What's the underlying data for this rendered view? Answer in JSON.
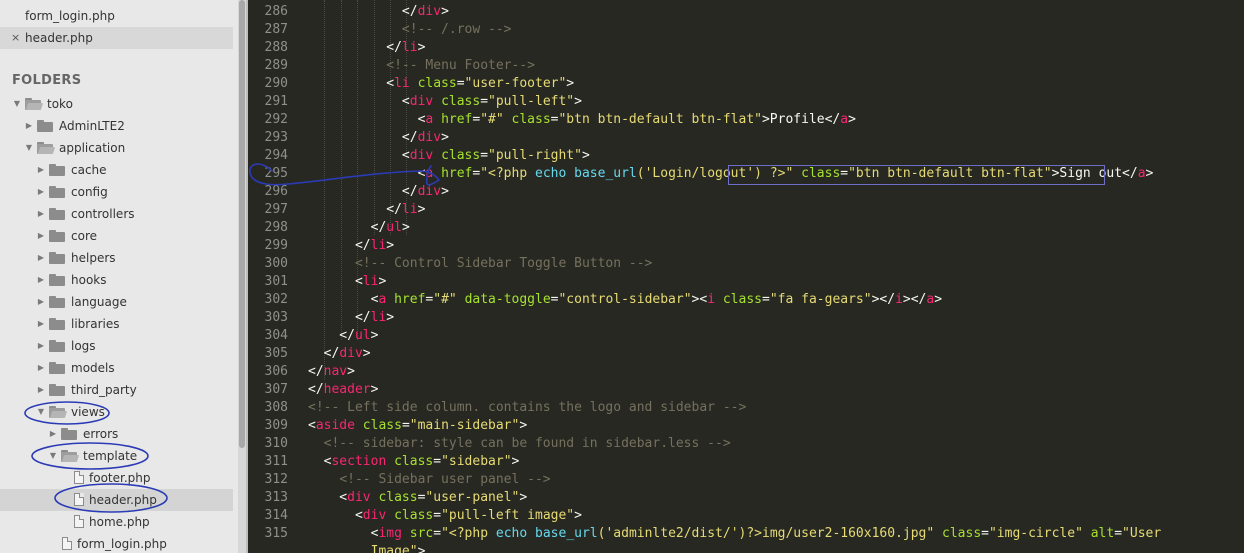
{
  "open_files": [
    {
      "name": "form_login.php"
    },
    {
      "name": "header.php",
      "close": "×"
    }
  ],
  "folders_heading": "FOLDERS",
  "tree": [
    {
      "label": "toko",
      "type": "folder-open"
    },
    {
      "label": "AdminLTE2",
      "type": "folder"
    },
    {
      "label": "application",
      "type": "folder-open"
    },
    {
      "label": "cache",
      "type": "folder"
    },
    {
      "label": "config",
      "type": "folder"
    },
    {
      "label": "controllers",
      "type": "folder"
    },
    {
      "label": "core",
      "type": "folder"
    },
    {
      "label": "helpers",
      "type": "folder"
    },
    {
      "label": "hooks",
      "type": "folder"
    },
    {
      "label": "language",
      "type": "folder"
    },
    {
      "label": "libraries",
      "type": "folder"
    },
    {
      "label": "logs",
      "type": "folder"
    },
    {
      "label": "models",
      "type": "folder"
    },
    {
      "label": "third_party",
      "type": "folder"
    },
    {
      "label": "views",
      "type": "folder-open"
    },
    {
      "label": "errors",
      "type": "folder"
    },
    {
      "label": "template",
      "type": "folder-open"
    },
    {
      "label": "footer.php",
      "type": "file"
    },
    {
      "label": "header.php",
      "type": "file"
    },
    {
      "label": "home.php",
      "type": "file"
    },
    {
      "label": "form_login.php",
      "type": "file"
    }
  ],
  "code_lines": [
    {
      "n": "286",
      "tokens": [
        [
          "p",
          "            "
        ],
        [
          "p",
          "</"
        ],
        [
          "t",
          "div"
        ],
        [
          "p",
          ">"
        ]
      ]
    },
    {
      "n": "287",
      "tokens": [
        [
          "p",
          "            "
        ],
        [
          "c",
          "<!-- /.row -->"
        ]
      ]
    },
    {
      "n": "288",
      "tokens": [
        [
          "p",
          "          </"
        ],
        [
          "t",
          "li"
        ],
        [
          "p",
          ">"
        ]
      ]
    },
    {
      "n": "289",
      "tokens": [
        [
          "p",
          "          "
        ],
        [
          "c",
          "<!-- Menu Footer-->"
        ]
      ]
    },
    {
      "n": "290",
      "tokens": [
        [
          "p",
          "          <"
        ],
        [
          "t",
          "li"
        ],
        [
          "p",
          " "
        ],
        [
          "a",
          "class"
        ],
        [
          "p",
          "="
        ],
        [
          "s",
          "\"user-footer\""
        ],
        [
          "p",
          ">"
        ]
      ]
    },
    {
      "n": "291",
      "tokens": [
        [
          "p",
          "            <"
        ],
        [
          "t",
          "div"
        ],
        [
          "p",
          " "
        ],
        [
          "a",
          "class"
        ],
        [
          "p",
          "="
        ],
        [
          "s",
          "\"pull-left\""
        ],
        [
          "p",
          ">"
        ]
      ]
    },
    {
      "n": "292",
      "tokens": [
        [
          "p",
          "              <"
        ],
        [
          "t",
          "a"
        ],
        [
          "p",
          " "
        ],
        [
          "a",
          "href"
        ],
        [
          "p",
          "="
        ],
        [
          "s",
          "\"#\""
        ],
        [
          "p",
          " "
        ],
        [
          "a",
          "class"
        ],
        [
          "p",
          "="
        ],
        [
          "s",
          "\"btn btn-default btn-flat\""
        ],
        [
          "p",
          ">Profile</"
        ],
        [
          "t",
          "a"
        ],
        [
          "p",
          ">"
        ]
      ]
    },
    {
      "n": "293",
      "tokens": [
        [
          "p",
          "            </"
        ],
        [
          "t",
          "div"
        ],
        [
          "p",
          ">"
        ]
      ]
    },
    {
      "n": "294",
      "tokens": [
        [
          "p",
          "            <"
        ],
        [
          "t",
          "div"
        ],
        [
          "p",
          " "
        ],
        [
          "a",
          "class"
        ],
        [
          "p",
          "="
        ],
        [
          "s",
          "\"pull-right\""
        ],
        [
          "p",
          ">"
        ]
      ]
    },
    {
      "n": "295",
      "tokens": [
        [
          "p",
          "              <"
        ],
        [
          "t",
          "a"
        ],
        [
          "p",
          " "
        ],
        [
          "a",
          "href"
        ],
        [
          "p",
          "="
        ],
        [
          "s",
          "\"<?php "
        ],
        [
          "f",
          "echo"
        ],
        [
          "s",
          " "
        ],
        [
          "f",
          "base_url"
        ],
        [
          "s",
          "('Login/logout') ?>\""
        ],
        [
          "p",
          " "
        ],
        [
          "a",
          "class"
        ],
        [
          "p",
          "="
        ],
        [
          "s",
          "\"btn btn-default btn-flat\""
        ],
        [
          "p",
          ">Sign out</"
        ],
        [
          "t",
          "a"
        ],
        [
          "p",
          ">"
        ]
      ]
    },
    {
      "n": "296",
      "tokens": [
        [
          "p",
          "            </"
        ],
        [
          "t",
          "div"
        ],
        [
          "p",
          ">"
        ]
      ]
    },
    {
      "n": "297",
      "tokens": [
        [
          "p",
          "          </"
        ],
        [
          "t",
          "li"
        ],
        [
          "p",
          ">"
        ]
      ]
    },
    {
      "n": "298",
      "tokens": [
        [
          "p",
          "        </"
        ],
        [
          "t",
          "ul"
        ],
        [
          "p",
          ">"
        ]
      ]
    },
    {
      "n": "299",
      "tokens": [
        [
          "p",
          "      </"
        ],
        [
          "t",
          "li"
        ],
        [
          "p",
          ">"
        ]
      ]
    },
    {
      "n": "300",
      "tokens": [
        [
          "p",
          "      "
        ],
        [
          "c",
          "<!-- Control Sidebar Toggle Button -->"
        ]
      ]
    },
    {
      "n": "301",
      "tokens": [
        [
          "p",
          "      <"
        ],
        [
          "t",
          "li"
        ],
        [
          "p",
          ">"
        ]
      ]
    },
    {
      "n": "302",
      "tokens": [
        [
          "p",
          "        <"
        ],
        [
          "t",
          "a"
        ],
        [
          "p",
          " "
        ],
        [
          "a",
          "href"
        ],
        [
          "p",
          "="
        ],
        [
          "s",
          "\"#\""
        ],
        [
          "p",
          " "
        ],
        [
          "a",
          "data-toggle"
        ],
        [
          "p",
          "="
        ],
        [
          "s",
          "\"control-sidebar\""
        ],
        [
          "p",
          "><"
        ],
        [
          "t",
          "i"
        ],
        [
          "p",
          " "
        ],
        [
          "a",
          "class"
        ],
        [
          "p",
          "="
        ],
        [
          "s",
          "\"fa fa-gears\""
        ],
        [
          "p",
          "></"
        ],
        [
          "t",
          "i"
        ],
        [
          "p",
          "></"
        ],
        [
          "t",
          "a"
        ],
        [
          "p",
          ">"
        ]
      ]
    },
    {
      "n": "303",
      "tokens": [
        [
          "p",
          "      </"
        ],
        [
          "t",
          "li"
        ],
        [
          "p",
          ">"
        ]
      ]
    },
    {
      "n": "304",
      "tokens": [
        [
          "p",
          "    </"
        ],
        [
          "t",
          "ul"
        ],
        [
          "p",
          ">"
        ]
      ]
    },
    {
      "n": "305",
      "tokens": [
        [
          "p",
          "  </"
        ],
        [
          "t",
          "div"
        ],
        [
          "p",
          ">"
        ]
      ]
    },
    {
      "n": "306",
      "tokens": [
        [
          "p",
          "</"
        ],
        [
          "t",
          "nav"
        ],
        [
          "p",
          ">"
        ]
      ]
    },
    {
      "n": "307",
      "tokens": [
        [
          "p",
          "</"
        ],
        [
          "t",
          "header"
        ],
        [
          "p",
          ">"
        ]
      ]
    },
    {
      "n": "308",
      "tokens": [
        [
          "c",
          "<!-- Left side column. contains the logo and sidebar -->"
        ]
      ]
    },
    {
      "n": "309",
      "tokens": [
        [
          "p",
          "<"
        ],
        [
          "t",
          "aside"
        ],
        [
          "p",
          " "
        ],
        [
          "a",
          "class"
        ],
        [
          "p",
          "="
        ],
        [
          "s",
          "\"main-sidebar\""
        ],
        [
          "p",
          ">"
        ]
      ]
    },
    {
      "n": "310",
      "tokens": [
        [
          "p",
          "  "
        ],
        [
          "c",
          "<!-- sidebar: style can be found in sidebar.less -->"
        ]
      ]
    },
    {
      "n": "311",
      "tokens": [
        [
          "p",
          "  <"
        ],
        [
          "t",
          "section"
        ],
        [
          "p",
          " "
        ],
        [
          "a",
          "class"
        ],
        [
          "p",
          "="
        ],
        [
          "s",
          "\"sidebar\""
        ],
        [
          "p",
          ">"
        ]
      ]
    },
    {
      "n": "312",
      "tokens": [
        [
          "p",
          "    "
        ],
        [
          "c",
          "<!-- Sidebar user panel -->"
        ]
      ]
    },
    {
      "n": "313",
      "tokens": [
        [
          "p",
          "    <"
        ],
        [
          "t",
          "div"
        ],
        [
          "p",
          " "
        ],
        [
          "a",
          "class"
        ],
        [
          "p",
          "="
        ],
        [
          "s",
          "\"user-panel\""
        ],
        [
          "p",
          ">"
        ]
      ]
    },
    {
      "n": "314",
      "tokens": [
        [
          "p",
          "      <"
        ],
        [
          "t",
          "div"
        ],
        [
          "p",
          " "
        ],
        [
          "a",
          "class"
        ],
        [
          "p",
          "="
        ],
        [
          "s",
          "\"pull-left image\""
        ],
        [
          "p",
          ">"
        ]
      ]
    },
    {
      "n": "315",
      "tokens": [
        [
          "p",
          "        <"
        ],
        [
          "t",
          "img"
        ],
        [
          "p",
          " "
        ],
        [
          "a",
          "src"
        ],
        [
          "p",
          "="
        ],
        [
          "s",
          "\"<?php "
        ],
        [
          "f",
          "echo"
        ],
        [
          "s",
          " "
        ],
        [
          "f",
          "base_url"
        ],
        [
          "s",
          "('adminlte2/dist/')?>img/user2-160x160.jpg\""
        ],
        [
          "p",
          " "
        ],
        [
          "a",
          "class"
        ],
        [
          "p",
          "="
        ],
        [
          "s",
          "\"img-circle\""
        ],
        [
          "p",
          " "
        ],
        [
          "a",
          "alt"
        ],
        [
          "p",
          "="
        ],
        [
          "s",
          "\"User"
        ]
      ]
    },
    {
      "n": "",
      "tokens": [
        [
          "p",
          "        "
        ],
        [
          "s",
          "Image\""
        ],
        [
          "p",
          ">"
        ]
      ]
    }
  ]
}
